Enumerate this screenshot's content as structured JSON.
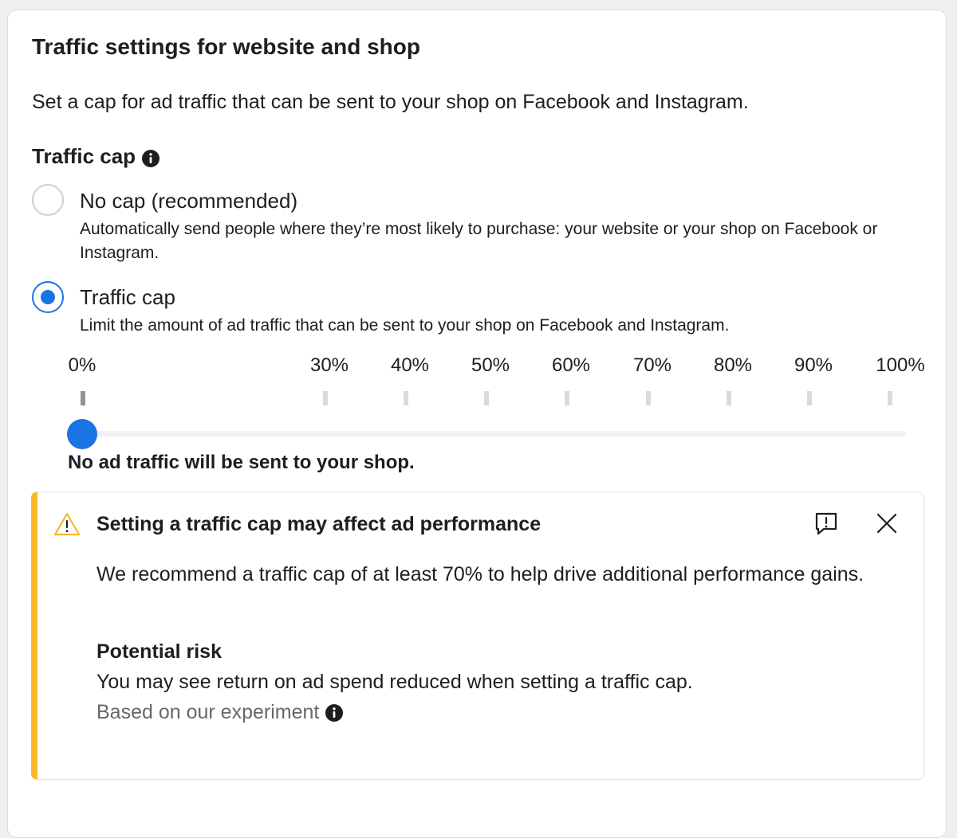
{
  "panel": {
    "title": "Traffic settings for website and shop",
    "description": "Set a cap for ad traffic that can be sent to your shop on Facebook and Instagram."
  },
  "traffic_cap": {
    "label": "Traffic cap",
    "label_icon": "info-icon",
    "options": [
      {
        "title": "No cap (recommended)",
        "description": "Automatically send people where they’re most likely to purchase: your website or your shop on Facebook or Instagram.",
        "selected": false
      },
      {
        "title": "Traffic cap",
        "description": "Limit the amount of ad traffic that can be sent to your shop on Facebook and Instagram.",
        "selected": true
      }
    ]
  },
  "slider": {
    "tick_labels": [
      "0%",
      "30%",
      "40%",
      "50%",
      "60%",
      "70%",
      "80%",
      "90%",
      "100%"
    ],
    "value_percent": 0,
    "message": "No ad traffic will be sent to your shop."
  },
  "alert": {
    "icon": "warning-triangle-icon",
    "title": "Setting a traffic cap may affect ad performance",
    "body": "We recommend a traffic cap of at least 70% to help drive additional performance gains.",
    "risk_title": "Potential risk",
    "risk_text": "You may see return on ad spend reduced when setting a traffic cap.",
    "risk_source": "Based on our experiment",
    "actions": [
      "feedback-icon",
      "close-icon"
    ]
  },
  "colors": {
    "accent": "#1b74e4",
    "warning": "#f7b928",
    "text": "#1c1e21",
    "secondary_text": "#65676b"
  }
}
